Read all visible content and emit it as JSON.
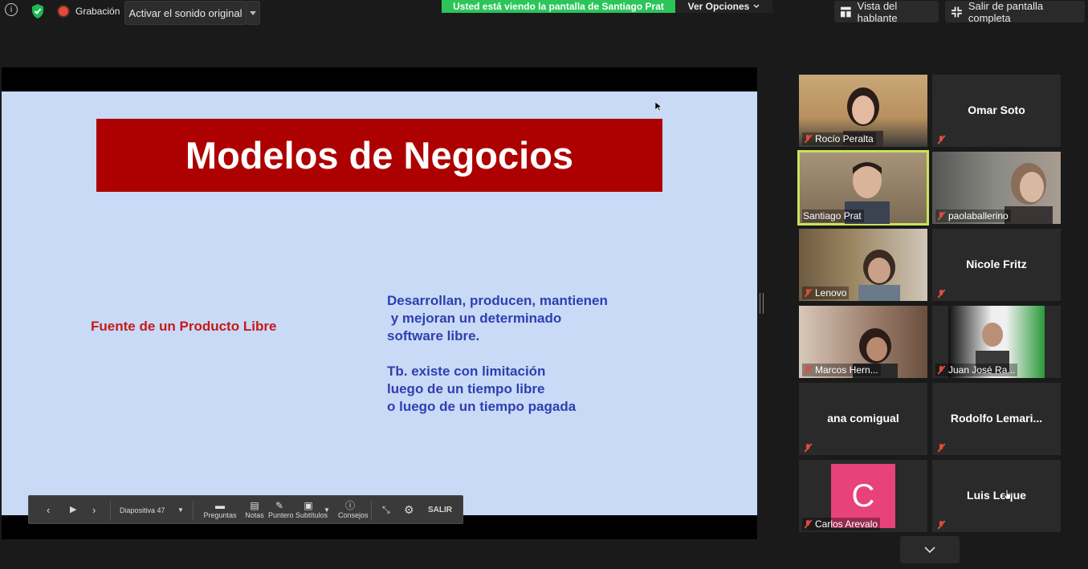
{
  "topbar": {
    "recording_label": "Grabación",
    "audio_button": "Activar el sonido original",
    "share_banner": "Usted está viendo la pantalla de Santiago Prat",
    "view_options": "Ver Opciones",
    "speaker_view": "Vista del hablante",
    "exit_fullscreen": "Salir de pantalla completa"
  },
  "slide": {
    "title": "Modelos de Negocios",
    "left_text": "Fuente de un Producto Libre",
    "right_lines": [
      "Desarrollan, producen, mantienen",
      " y mejoran un determinado",
      "software libre.",
      "",
      "Tb. existe con limitación",
      "luego de un tiempo libre",
      "o luego de un tiempo pagada"
    ]
  },
  "presenter_toolbar": {
    "slide_label": "Diapositiva 47",
    "questions": "Preguntas",
    "notes": "Notas",
    "pointer": "Puntero",
    "subtitles": "Subtítulos",
    "tips": "Consejos",
    "exit": "SALIR"
  },
  "participants": [
    {
      "name": "Rocío Peralta",
      "video": true
    },
    {
      "name": "Omar Soto",
      "video": false
    },
    {
      "name": "Santiago Prat",
      "video": true,
      "active_speaker": true
    },
    {
      "name": "paolaballerino",
      "video": true
    },
    {
      "name": "Lenovo",
      "video": true
    },
    {
      "name": "Nicole Fritz",
      "video": false
    },
    {
      "name": "Marcos Hern...",
      "video": true
    },
    {
      "name": "Juan José Ra...",
      "video": true
    },
    {
      "name": "ana comigual",
      "video": false
    },
    {
      "name": "Rodolfo  Lemari...",
      "video": false
    },
    {
      "name": "Carlos Arevalo",
      "video": false,
      "avatar_letter": "C",
      "avatar_color": "#e8427a"
    },
    {
      "name": "Luis Leque",
      "video": false
    }
  ],
  "colors": {
    "share_banner": "#2bc55a",
    "slide_bg": "#c8daf6",
    "title_box": "#ad0000",
    "active_speaker_border": "#c9e35a"
  }
}
